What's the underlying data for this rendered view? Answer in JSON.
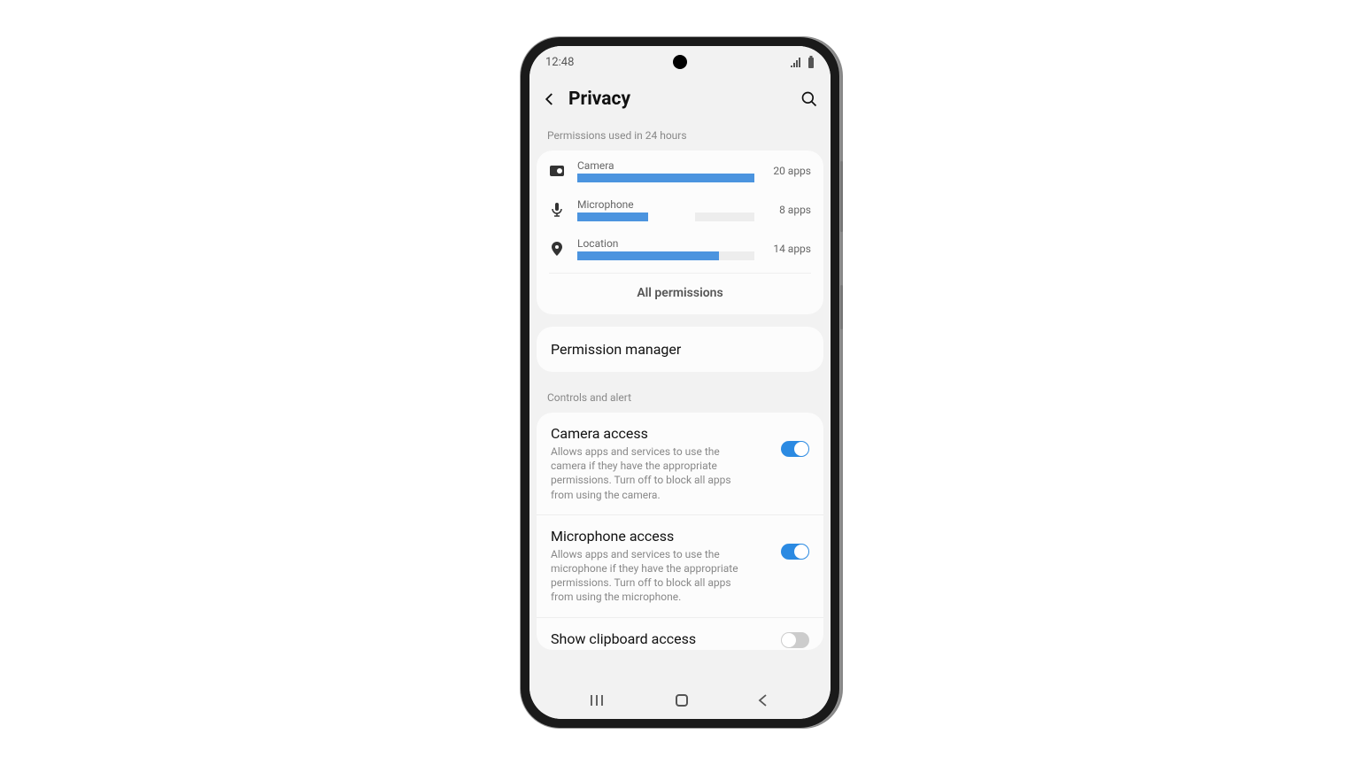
{
  "status_bar": {
    "time": "12:48"
  },
  "header": {
    "title": "Privacy"
  },
  "usage_section": {
    "label": "Permissions used in 24 hours",
    "rows": [
      {
        "name": "Camera",
        "count": "20 apps",
        "fill_pct": 100
      },
      {
        "name": "Microphone",
        "count": "8 apps",
        "fill_pct": 40
      },
      {
        "name": "Location",
        "count": "14 apps",
        "fill_pct": 80
      }
    ],
    "all_link": "All permissions"
  },
  "permission_manager": {
    "title": "Permission manager"
  },
  "controls_section": {
    "label": "Controls and alert",
    "items": [
      {
        "title": "Camera access",
        "desc": "Allows apps and services to use the camera if they have the appropriate permissions. Turn off to block all apps from using the camera.",
        "on": true
      },
      {
        "title": "Microphone access",
        "desc": "Allows apps and services to use the microphone if they have the appropriate permissions. Turn off to block all apps from using the microphone.",
        "on": true
      },
      {
        "title": "Show clipboard access",
        "desc": "",
        "on": false
      }
    ]
  },
  "chart_data": {
    "type": "bar",
    "title": "Permissions used in 24 hours",
    "categories": [
      "Camera",
      "Microphone",
      "Location"
    ],
    "values": [
      20,
      8,
      14
    ],
    "ylabel": "apps",
    "ylim": [
      0,
      20
    ]
  }
}
